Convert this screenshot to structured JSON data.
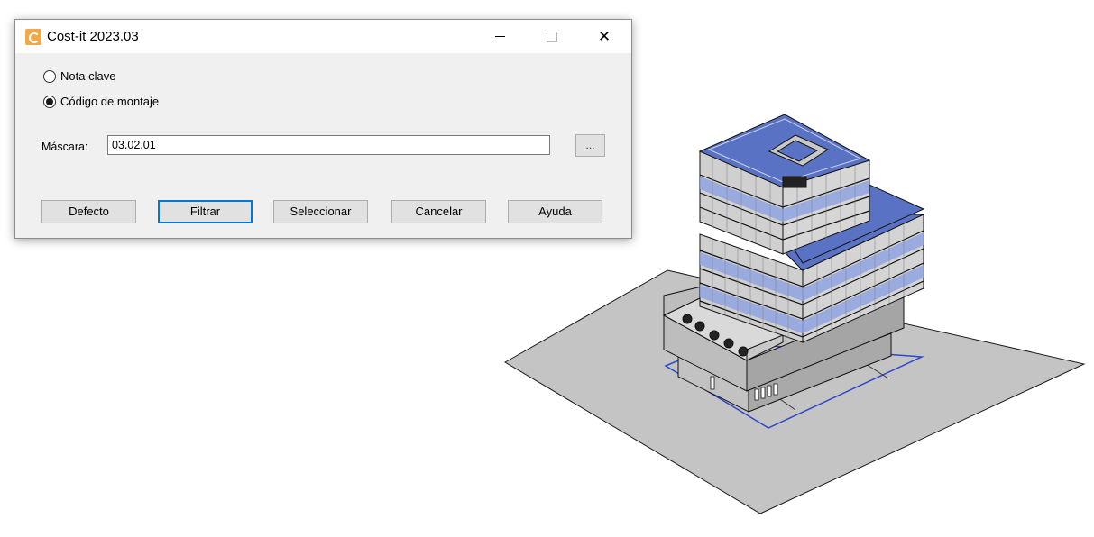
{
  "window": {
    "title": "Cost-it 2023.03",
    "app_icon": "cost-it-app-icon",
    "controls": {
      "minimize_icon": "minimize-icon",
      "maximize_icon": "maximize-icon",
      "close_icon": "close-icon",
      "close_glyph": "✕"
    }
  },
  "options": {
    "nota_clave": {
      "label": "Nota clave",
      "checked": false
    },
    "codigo_montaje": {
      "label": "Código de montaje",
      "checked": true
    }
  },
  "mask": {
    "label": "Máscara:",
    "value": "03.02.01",
    "browse_label": "..."
  },
  "buttons": {
    "defecto": "Defecto",
    "filtrar": "Filtrar",
    "seleccionar": "Seleccionar",
    "cancelar": "Cancelar",
    "ayuda": "Ayuda"
  },
  "colors": {
    "accent": "#0078d7",
    "roof_blue": "#5a72c4",
    "glass_blue": "#8fa3e0",
    "ground": "#c4c4c4",
    "wall": "#b9b9b9"
  }
}
